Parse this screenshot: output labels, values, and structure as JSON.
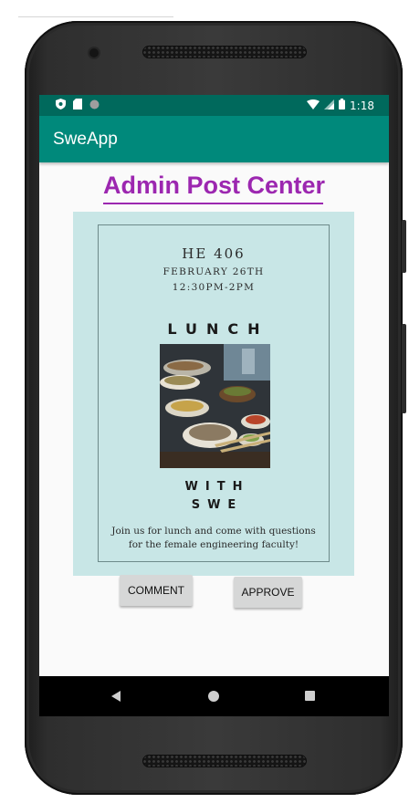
{
  "status_bar": {
    "time": "1:18",
    "icons": [
      "shield-icon",
      "sd-card-icon",
      "circle-icon",
      "wifi-icon",
      "signal-icon",
      "battery-icon"
    ]
  },
  "app_bar": {
    "title": "SweApp"
  },
  "page": {
    "heading": "Admin Post Center"
  },
  "poster": {
    "room": "HE 406",
    "date": "FEBRUARY 26TH",
    "time": "12:30PM-2PM",
    "headline": "LUNCH",
    "with_line": "WITH",
    "org_line": "SWE",
    "body": "Join us for lunch and come with questions for the female engineering faculty!",
    "photo": "food-buffet-photo",
    "colors": {
      "background": "#c8e6e6",
      "frame": "#6d8a8a",
      "text": "#2a2a2a"
    }
  },
  "actions": {
    "comment_label": "COMMENT",
    "approve_label": "APPROVE"
  },
  "nav_bar": {
    "icons": [
      "back-icon",
      "home-icon",
      "recents-icon"
    ]
  },
  "colors": {
    "status_bar": "#00695c",
    "app_bar": "#00897b",
    "heading": "#9c27b0",
    "button": "#d6d7d7"
  }
}
